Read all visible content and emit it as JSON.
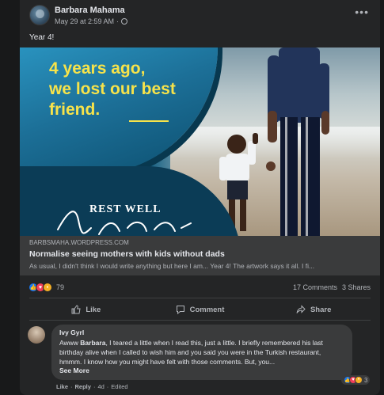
{
  "post": {
    "author": "Barbara Mahama",
    "timestamp": "May 29 at 2:59 AM",
    "separator": "·",
    "text": "Year 4!"
  },
  "link_image": {
    "headline_line1": "4 years ago,",
    "headline_line2": "we lost our best",
    "headline_line3": "friend.",
    "rest_well": "REST WELL",
    "colors": {
      "teal": "#1c6f97",
      "yellow": "#f7e34a"
    }
  },
  "link_preview": {
    "domain": "BARBSMAHA.WORDPRESS.COM",
    "title": "Normalise seeing mothers with kids without dads",
    "description": "As usual, I didn't think I would write anything but here I am... Year 4! The artwork says it all. I fi..."
  },
  "stats": {
    "reaction_count": "79",
    "comments": "17 Comments",
    "shares": "3 Shares",
    "reaction_icons": [
      "like-icon",
      "love-icon",
      "sad-icon"
    ]
  },
  "actions": {
    "like": "Like",
    "comment": "Comment",
    "share": "Share"
  },
  "comment": {
    "author": "Ivy Gyrl",
    "text_prefix": "Awww ",
    "text_mention": "Barbara",
    "text_body": ", I teared a little when I read this, just a little. I briefly remembered his last birthday alive when I called to wish him and you said you were in the Turkish restaurant, hmmm. I know how you might have felt with those comments. But, you...",
    "see_more": "See More",
    "reaction_count": "3",
    "like": "Like",
    "reply": "Reply",
    "time": "4d",
    "edited": "Edited",
    "dot": "·"
  }
}
